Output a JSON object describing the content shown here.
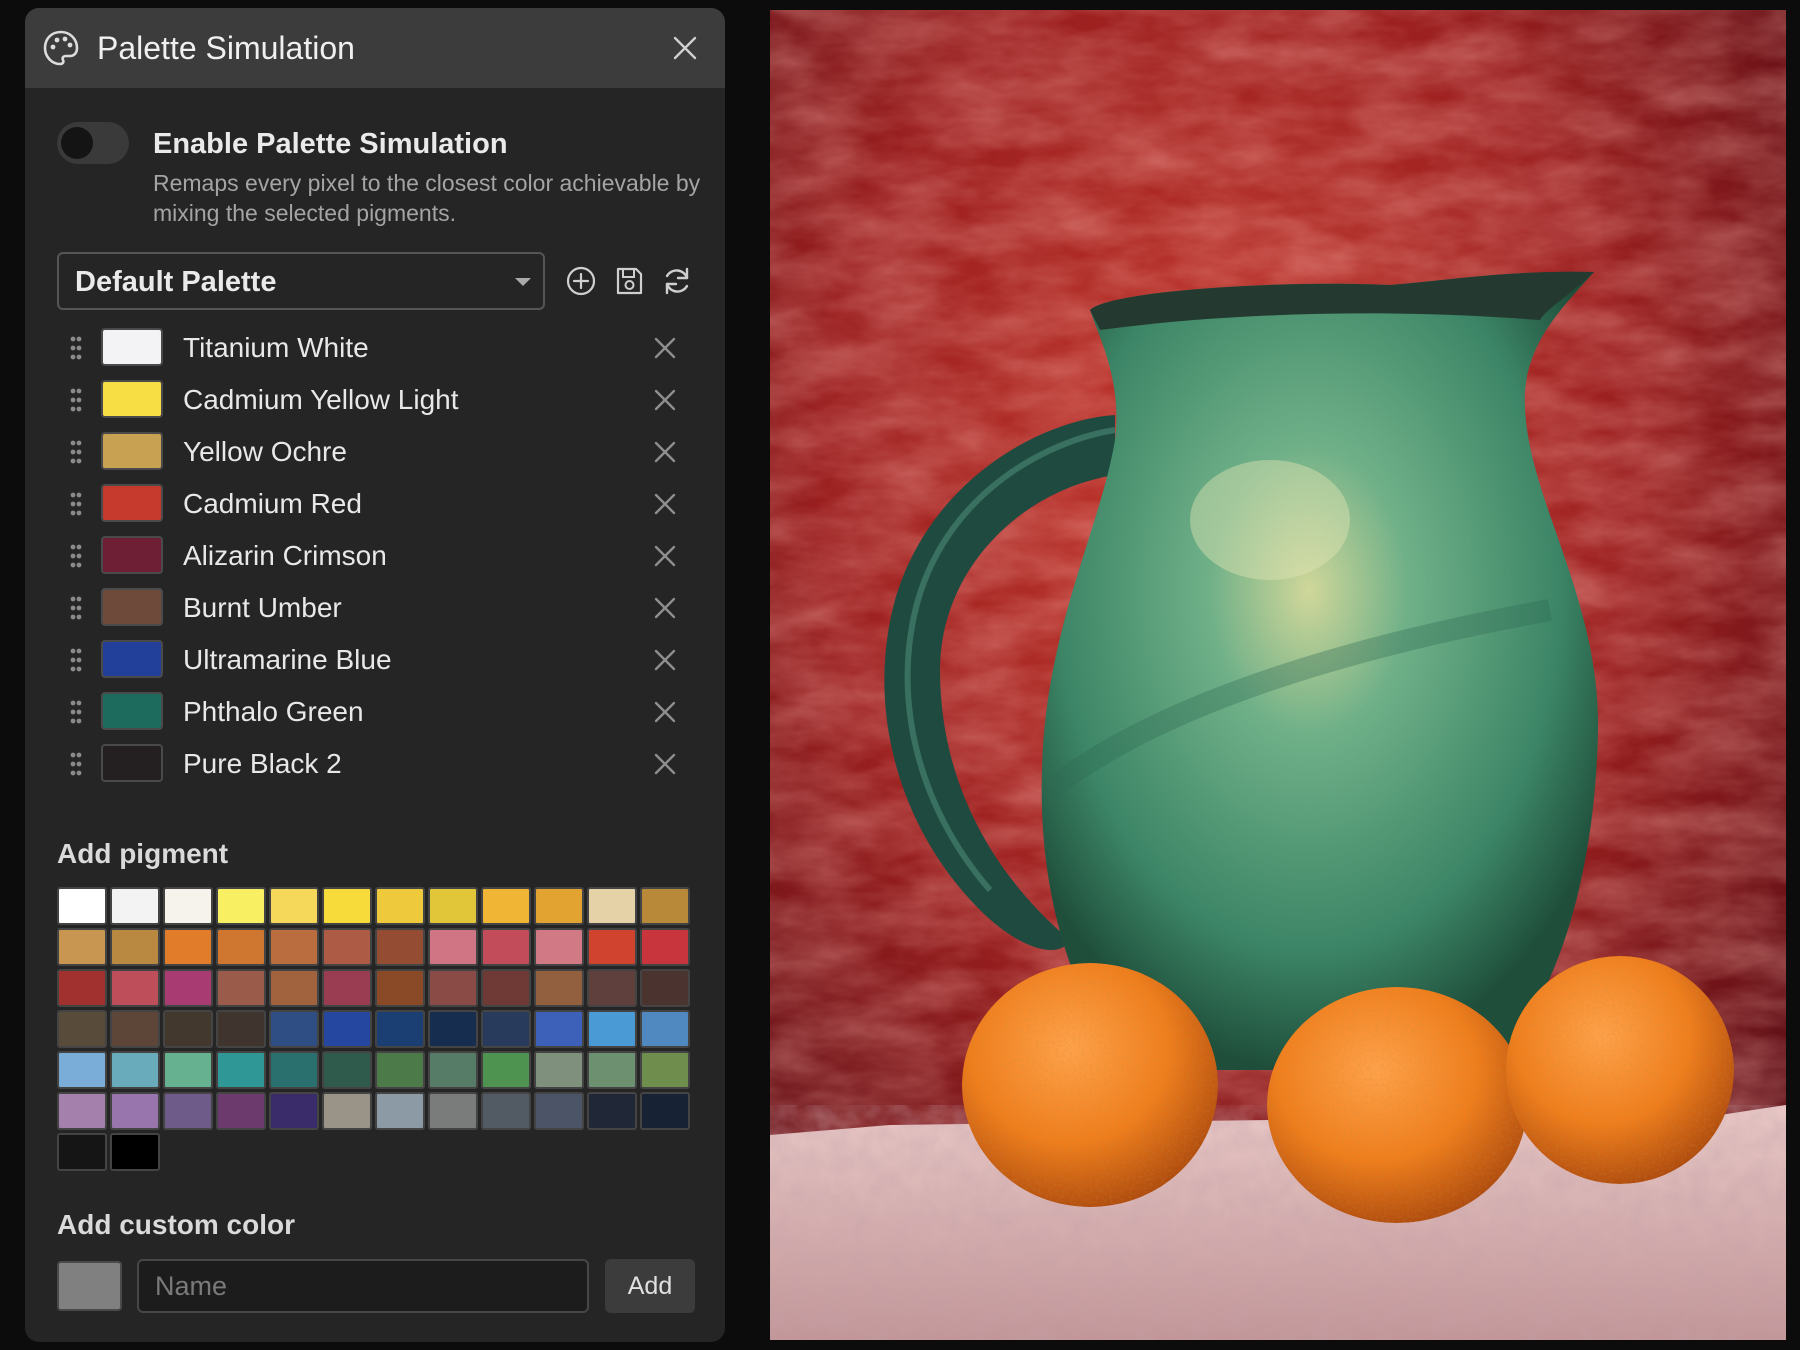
{
  "panel": {
    "title": "Palette Simulation",
    "icons": {
      "title": "palette-icon",
      "close": "close-icon"
    }
  },
  "simulation": {
    "enabled": false,
    "label": "Enable Palette Simulation",
    "description": "Remaps every pixel to the closest color achievable by mixing the selected pigments."
  },
  "palette_select": {
    "value": "Default Palette",
    "tool_icons": [
      "add-circle-icon",
      "save-icon",
      "refresh-icon"
    ]
  },
  "pigments": [
    {
      "name": "Titanium White",
      "color": "#f3f3f5"
    },
    {
      "name": "Cadmium Yellow Light",
      "color": "#f8de45"
    },
    {
      "name": "Yellow Ochre",
      "color": "#c9a152"
    },
    {
      "name": "Cadmium Red",
      "color": "#c63a2d"
    },
    {
      "name": "Alizarin Crimson",
      "color": "#6e1f36"
    },
    {
      "name": "Burnt Umber",
      "color": "#6e4a3b"
    },
    {
      "name": "Ultramarine Blue",
      "color": "#22409a"
    },
    {
      "name": "Phthalo Green",
      "color": "#1d6b5c"
    },
    {
      "name": "Pure Black 2",
      "color": "#241f20"
    }
  ],
  "add_pigment": {
    "heading": "Add pigment",
    "swatches": [
      "#ffffff",
      "#f3f3f3",
      "#f6f3ec",
      "#f8ef63",
      "#f5d75a",
      "#f7db3a",
      "#eec93b",
      "#e2c63a",
      "#f0b534",
      "#e3a330",
      "#e5d2a6",
      "#b9893a",
      "#c99651",
      "#b98942",
      "#e17c2b",
      "#cf7730",
      "#ba6d3e",
      "#ae5b45",
      "#944d33",
      "#d07584",
      "#c24c59",
      "#d17a86",
      "#d0432e",
      "#c9353c",
      "#a1312f",
      "#bf4e5b",
      "#a73b72",
      "#9a5b4b",
      "#a0633d",
      "#9b3d52",
      "#8b4a27",
      "#8a4a45",
      "#6f3a36",
      "#93603f",
      "#60403c",
      "#4b3430",
      "#594b3a",
      "#5d4638",
      "#42382e",
      "#3f342e",
      "#2f4e83",
      "#2647a0",
      "#1b3f73",
      "#172d4f",
      "#283b5c",
      "#3d60b8",
      "#4a9ad5",
      "#5088c0",
      "#7aaed8",
      "#6aabbb",
      "#66b290",
      "#2f9897",
      "#2a706e",
      "#2f5b4c",
      "#4d7a49",
      "#567b67",
      "#4e934f",
      "#7f907c",
      "#6d9070",
      "#6f8e4d",
      "#a480ad",
      "#9975ad",
      "#6e5b8a",
      "#6d3a6e",
      "#3a2c6b",
      "#9a9488",
      "#8c9aa5",
      "#7a7c7c",
      "#525a64",
      "#4b5567",
      "#202838",
      "#172234",
      "#151515",
      "#000000"
    ]
  },
  "custom_color": {
    "heading": "Add custom color",
    "swatch_color": "#808080",
    "name_placeholder": "Name",
    "name_value": "",
    "add_label": "Add"
  },
  "canvas": {
    "image": "still-life: green ceramic pitcher with three mandarin oranges on white cloth against red velvet background"
  }
}
